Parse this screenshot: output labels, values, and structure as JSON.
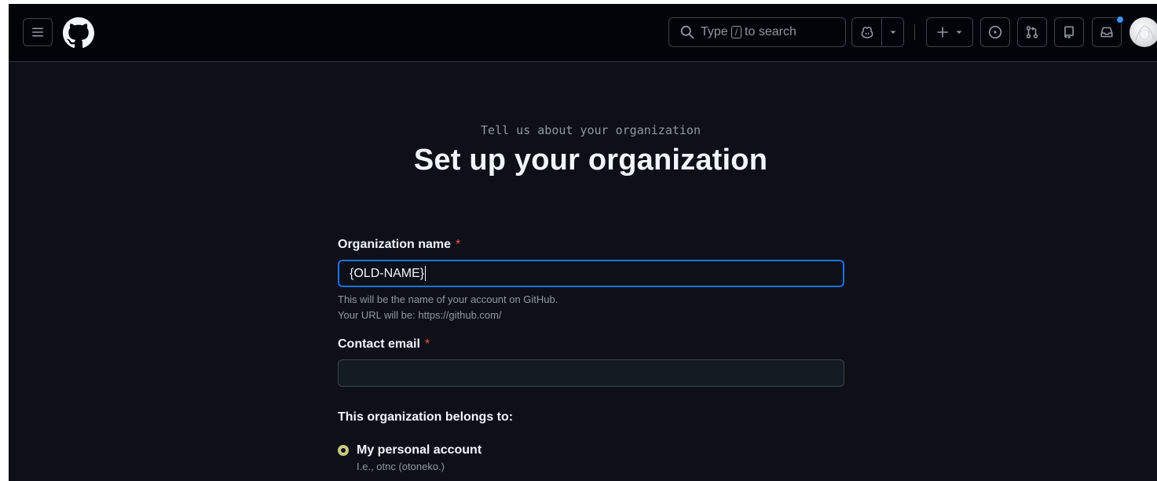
{
  "header": {
    "search_type": "Type",
    "search_key": "/",
    "search_suffix": "to search"
  },
  "page": {
    "eyebrow": "Tell us about your organization",
    "title": "Set up your organization"
  },
  "form": {
    "org_name_label": "Organization name",
    "required_mark": "*",
    "org_name_value": "{OLD-NAME}",
    "org_name_hint": "This will be the name of your account on GitHub.",
    "url_hint": "Your URL will be: https://github.com/",
    "email_label": "Contact email",
    "email_value": "",
    "belongs_label": "This organization belongs to:",
    "option_personal_label": "My personal account",
    "option_personal_hint": "I.e., otnc (otoneko.)"
  },
  "colors": {
    "header_bg": "#010409",
    "page_bg": "#0d1117",
    "focus_border": "#1f6feb",
    "required": "#f85149",
    "notification_dot": "#4493f8"
  },
  "icons": {
    "menu": "hamburger-icon",
    "logo": "github-logo",
    "search": "search-icon",
    "copilot": "copilot-icon",
    "create": "plus-icon",
    "issues": "issue-opened-icon",
    "pulls": "git-pull-request-icon",
    "repos": "repo-icon",
    "inbox": "inbox-icon"
  }
}
